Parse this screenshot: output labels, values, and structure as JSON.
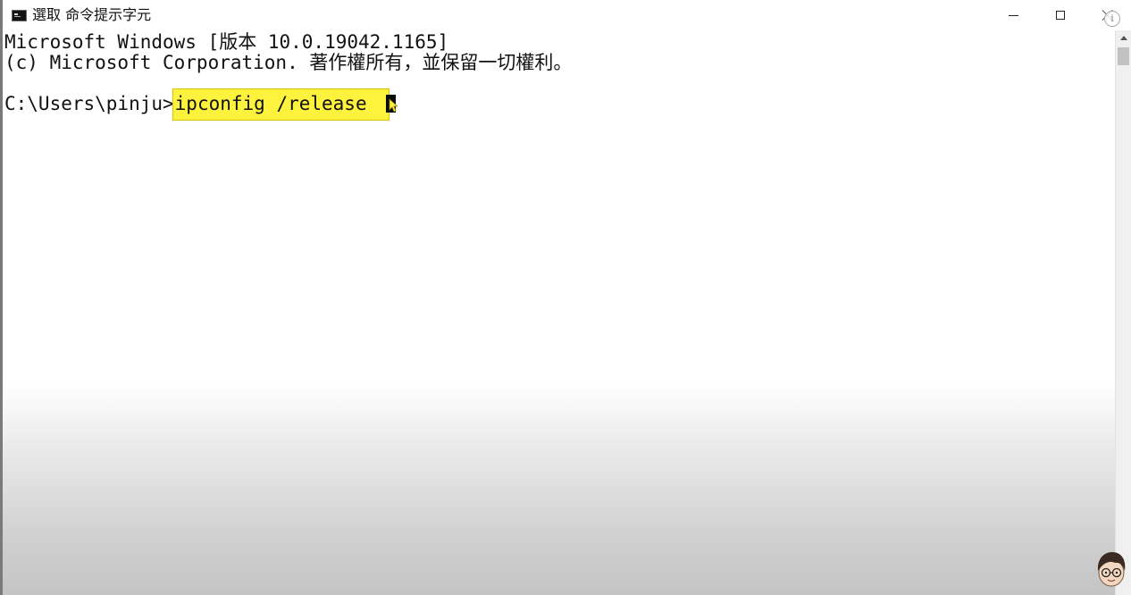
{
  "window": {
    "title": "選取 命令提示字元",
    "app_icon": "cmd-icon",
    "controls": {
      "minimize_icon": "minimize-icon",
      "maximize_icon": "maximize-icon",
      "close_icon": "close-icon",
      "info_glyph": "i"
    }
  },
  "console": {
    "lines": [
      "Microsoft Windows [版本 10.0.19042.1165]",
      "(c) Microsoft Corporation. 著作權所有，並保留一切權利。"
    ],
    "prompt": "C:\\Users\\pinju>",
    "command": "ipconfig /release",
    "highlight_color": "#fdf33c",
    "text_color": "#111111",
    "background_color": "#ffffff"
  },
  "overlay": {
    "avatar_icon": "avatar-icon"
  }
}
